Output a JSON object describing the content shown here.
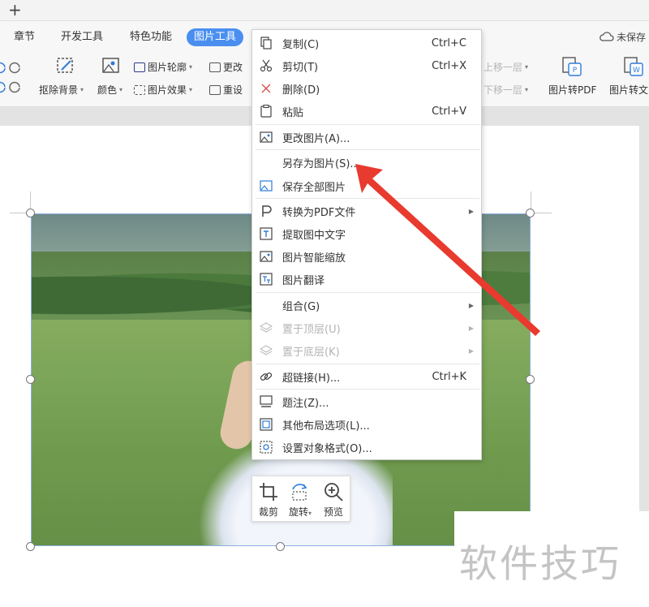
{
  "titlebar": {
    "new_tab_glyph": "+"
  },
  "tabs": [
    {
      "label": "章节",
      "active": false
    },
    {
      "label": "开发工具",
      "active": false
    },
    {
      "label": "特色功能",
      "active": false
    },
    {
      "label": "图片工具",
      "active": true
    }
  ],
  "status": {
    "save_state": "未保存"
  },
  "ribbon": {
    "remove_bg": "抠除背景",
    "color": "颜色",
    "outline": "图片轮廓",
    "effects": "图片效果",
    "change": "更改",
    "reset": "重设",
    "move_up": "上移一层",
    "move_down": "下移一层",
    "to_pdf": "图片转PDF",
    "to_text": "图片转文"
  },
  "context_menu": {
    "items": [
      {
        "label": "复制(C)",
        "shortcut": "Ctrl+C",
        "icon": "copy-icon"
      },
      {
        "label": "剪切(T)",
        "shortcut": "Ctrl+X",
        "icon": "scissors-icon"
      },
      {
        "label": "删除(D)",
        "icon": "delete-icon"
      },
      {
        "label": "粘贴",
        "shortcut": "Ctrl+V",
        "icon": "paste-icon"
      },
      {
        "label": "更改图片(A)...",
        "icon": "change-picture-icon"
      },
      {
        "label": "另存为图片(S)...",
        "icon": ""
      },
      {
        "label": "保存全部图片",
        "icon": "save-all-pictures-icon"
      },
      {
        "label": "转换为PDF文件",
        "submenu": true,
        "icon": "pdf-icon"
      },
      {
        "label": "提取图中文字",
        "icon": "extract-text-icon"
      },
      {
        "label": "图片智能缩放",
        "icon": "smart-scale-icon"
      },
      {
        "label": "图片翻译",
        "icon": "translate-icon"
      },
      {
        "label": "组合(G)",
        "submenu": true,
        "icon": ""
      },
      {
        "label": "置于顶层(U)",
        "submenu": true,
        "disabled": true,
        "icon": "bring-to-front-icon"
      },
      {
        "label": "置于底层(K)",
        "submenu": true,
        "disabled": true,
        "icon": "send-to-back-icon"
      },
      {
        "label": "超链接(H)...",
        "shortcut": "Ctrl+K",
        "icon": "link-icon"
      },
      {
        "label": "题注(Z)...",
        "icon": "caption-icon"
      },
      {
        "label": "其他布局选项(L)...",
        "icon": "layout-options-icon"
      },
      {
        "label": "设置对象格式(O)...",
        "icon": "format-object-icon"
      }
    ]
  },
  "mini_toolbar": {
    "crop": "裁剪",
    "rotate": "旋转",
    "preview": "预览"
  },
  "watermark": "软件技巧",
  "colors": {
    "accent": "#4a8ff0",
    "arrow": "#e83a2e",
    "disabled_text": "#b4b4b4"
  }
}
